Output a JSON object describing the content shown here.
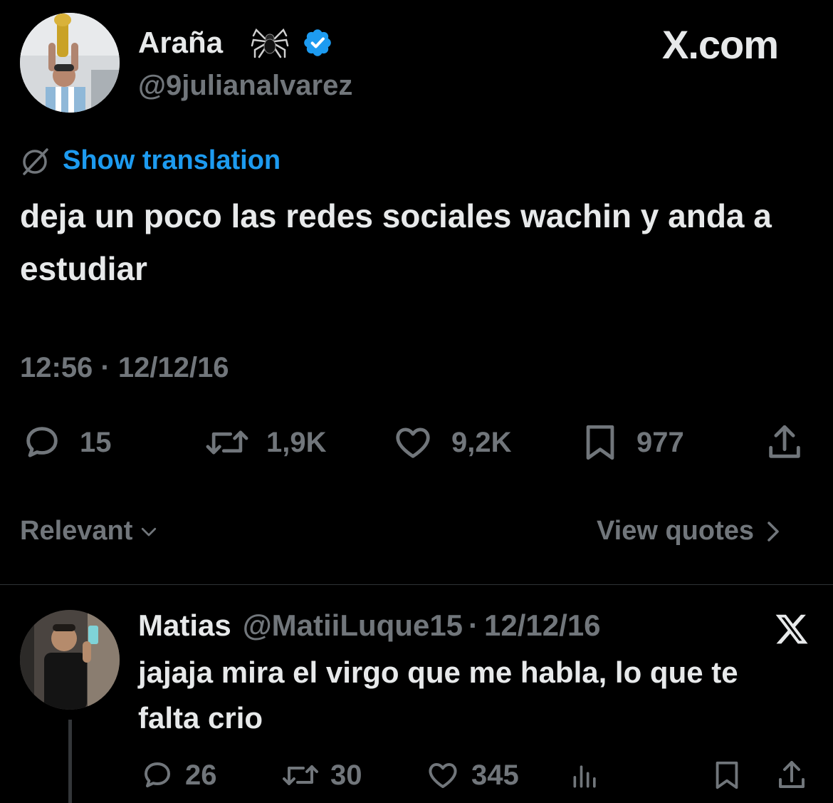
{
  "tweet": {
    "author": {
      "display_name": "Araña",
      "emoji": "🕷",
      "handle": "@9julianalvarez",
      "verified": true
    },
    "brand": "X.com",
    "translate_label": "Show translation",
    "text": "deja un poco las redes sociales wachin y anda a estudiar",
    "timestamp": "12:56 · 12/12/16",
    "metrics": {
      "replies": "15",
      "reposts": "1,9K",
      "likes": "9,2K",
      "bookmarks": "977"
    }
  },
  "sort": {
    "relevant_label": "Relevant",
    "view_quotes_label": "View quotes"
  },
  "reply": {
    "display_name": "Matias",
    "handle": "@MatiiLuque15",
    "separator": "·",
    "date": "12/12/16",
    "text": "jajaja mira el virgo que me habla, lo que te falta crio",
    "metrics": {
      "replies": "26",
      "reposts": "30",
      "likes": "345"
    }
  },
  "colors": {
    "background": "#000000",
    "text": "#e7e9ea",
    "secondary": "#71767b",
    "accent": "#1d9bf0",
    "divider": "#2f3336"
  },
  "icons": [
    "spider-icon",
    "verified-badge-icon",
    "translate-icon",
    "reply-icon",
    "repost-icon",
    "like-icon",
    "bookmark-icon",
    "share-icon",
    "chevron-down-icon",
    "chevron-right-icon",
    "x-logo-icon",
    "analytics-icon"
  ]
}
